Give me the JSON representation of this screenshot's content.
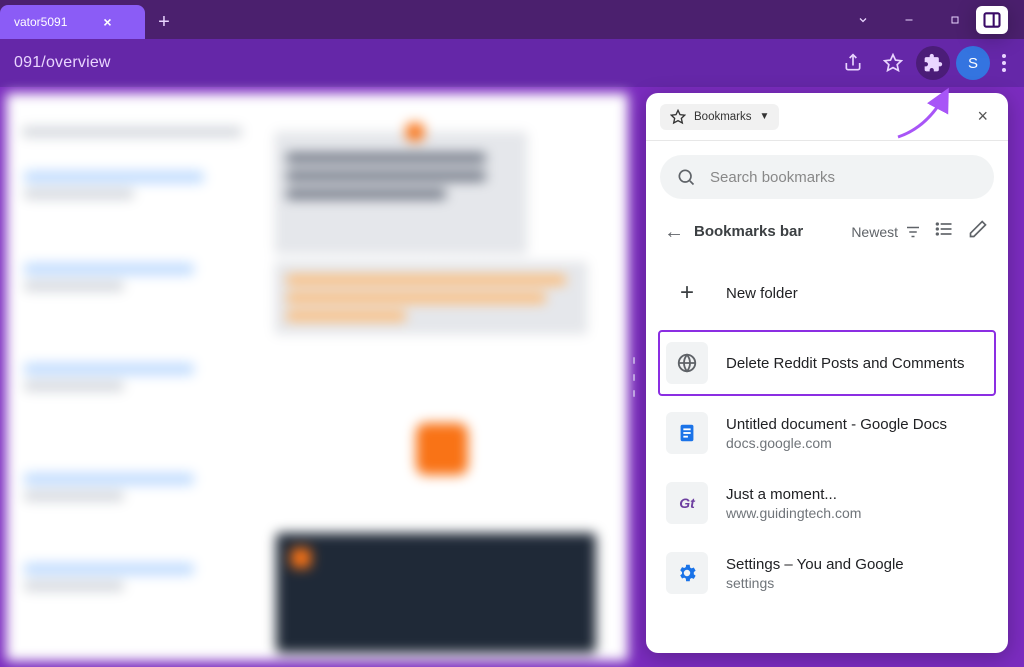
{
  "window": {
    "tab_title": "vator5091",
    "url_fragment": "091/overview",
    "avatar_letter": "S"
  },
  "panel": {
    "chip_label": "Bookmarks",
    "search_placeholder": "Search bookmarks",
    "section_title": "Bookmarks bar",
    "sort_label": "Newest",
    "rows": [
      {
        "title": "New folder",
        "sub": "",
        "icon": "plus"
      },
      {
        "title": "Delete Reddit Posts and Comments",
        "sub": "",
        "icon": "globe",
        "highlight": true
      },
      {
        "title": "Untitled document - Google Docs",
        "sub": "docs.google.com",
        "icon": "doc"
      },
      {
        "title": "Just a moment...",
        "sub": "www.guidingtech.com",
        "icon": "gt"
      },
      {
        "title": "Settings – You and Google",
        "sub": "settings",
        "icon": "gear"
      }
    ]
  }
}
